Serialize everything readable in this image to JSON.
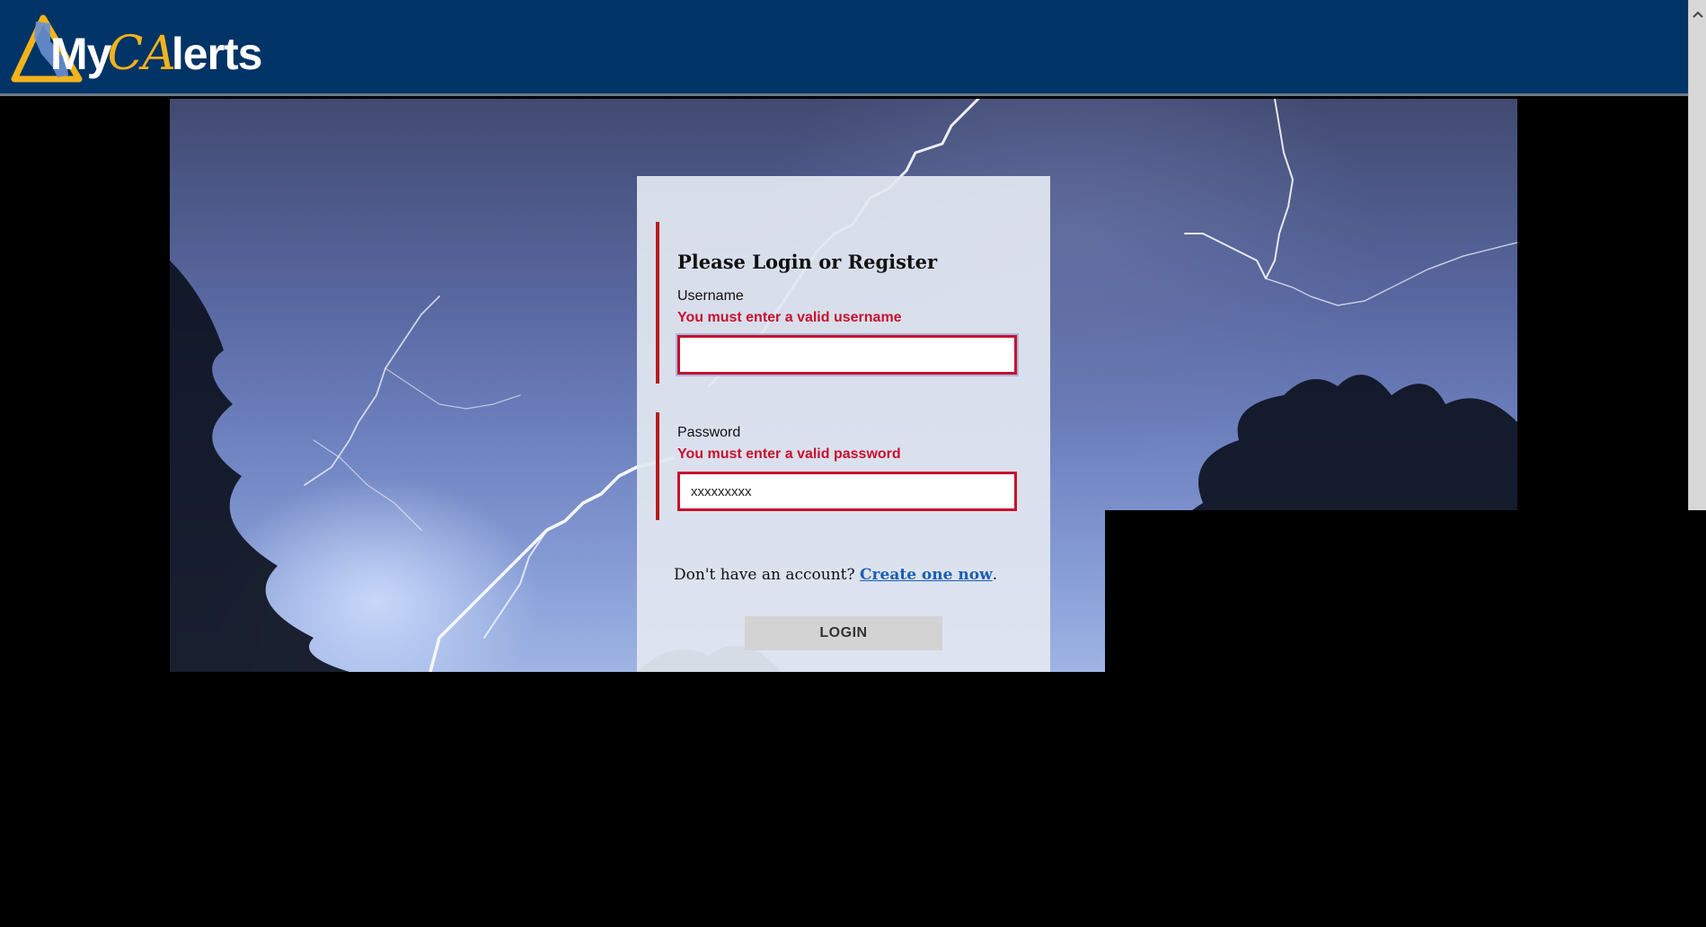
{
  "header": {
    "logo": {
      "prefix": "My",
      "script": "CA",
      "suffix": "lerts"
    }
  },
  "login_panel": {
    "title": "Please Login or Register",
    "username": {
      "label": "Username",
      "error": "You must enter a valid username",
      "value": ""
    },
    "password": {
      "label": "Password",
      "error": "You must enter a valid password",
      "value": "xxxxxxxxx"
    },
    "account_prompt": "Don't have an account?",
    "create_link": "Create one now",
    "account_suffix": ".",
    "login_button": "LOGIN"
  },
  "colors": {
    "header_bg": "#003366",
    "error": "#c8102e",
    "link": "#1a5fb4",
    "logo_accent": "#f2b31b"
  },
  "icons": {
    "logo_mark": "california-triangle-logo-icon",
    "scroll_up": "chevron-up-icon"
  }
}
